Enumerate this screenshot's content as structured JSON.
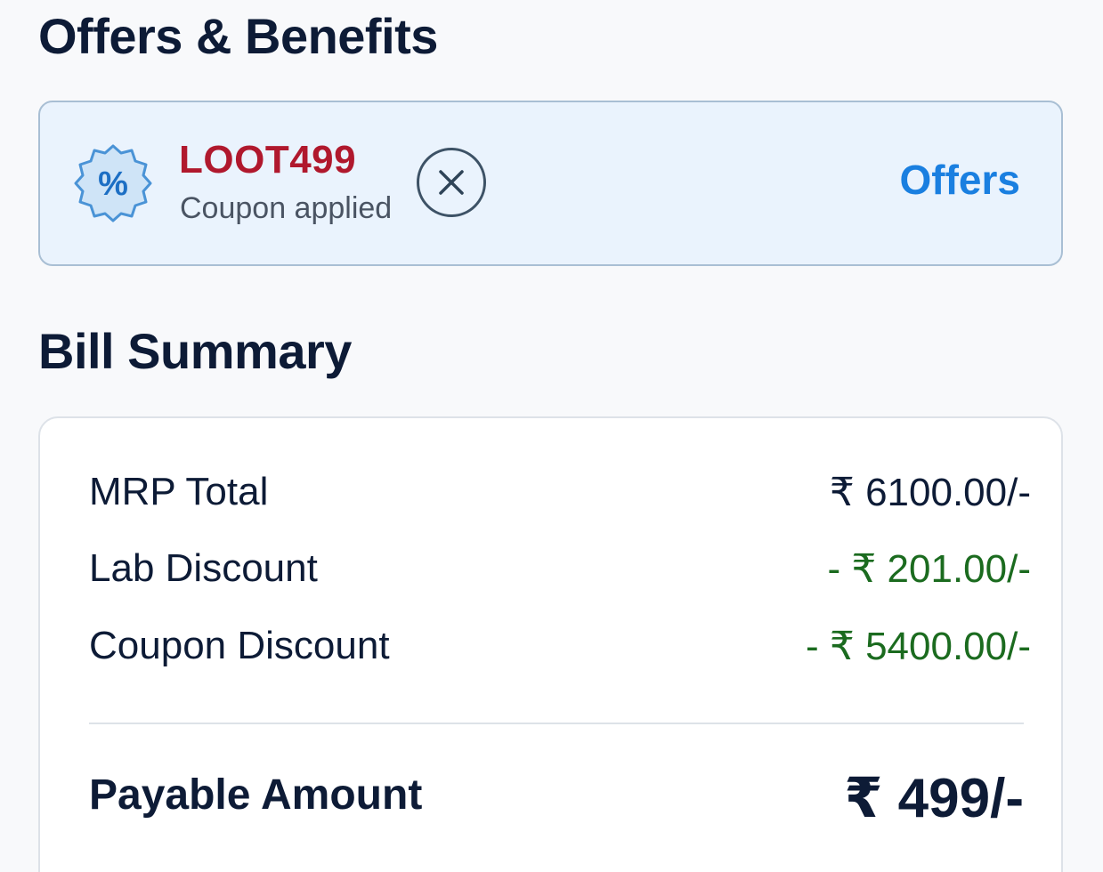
{
  "offers": {
    "title": "Offers & Benefits",
    "coupon_code": "LOOT499",
    "coupon_status": "Coupon applied",
    "badge_icon": "percent-badge-icon",
    "remove_icon": "close-icon",
    "offers_link": "Offers",
    "colors": {
      "card_bg": "#eaf3fd",
      "coupon_code": "#b0182d",
      "link": "#1a7fe0"
    }
  },
  "bill": {
    "title": "Bill Summary",
    "rows": [
      {
        "label": "MRP Total",
        "value": "₹ 6100.00/-"
      },
      {
        "label": "Lab Discount",
        "value": "- ₹ 201.00/-"
      },
      {
        "label": "Coupon Discount",
        "value": "- ₹ 5400.00/-"
      }
    ],
    "payable": {
      "label": "Payable Amount",
      "value": "₹ 499/-"
    },
    "colors": {
      "discount": "#1b6b1f"
    }
  }
}
